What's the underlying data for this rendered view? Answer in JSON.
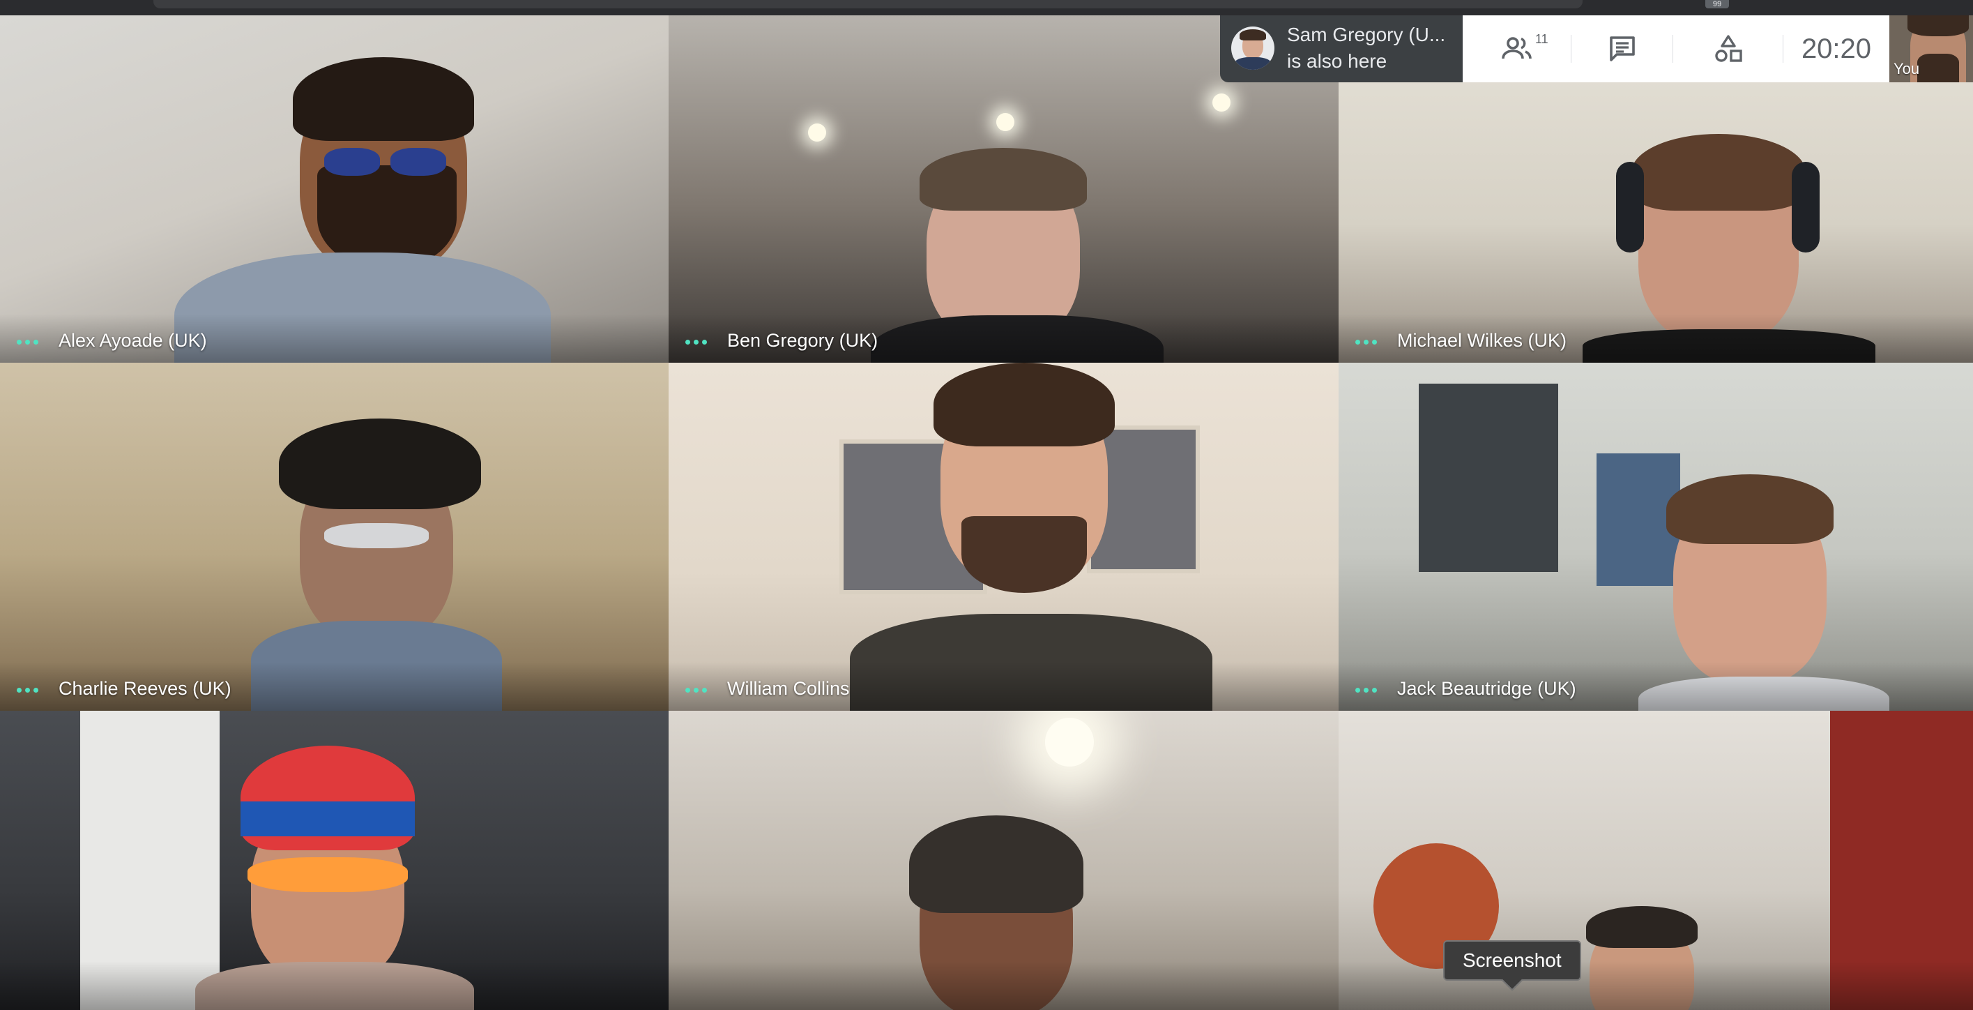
{
  "top_bar": {
    "notification_badge": "99"
  },
  "notification": {
    "name": "Sam Gregory (U...",
    "message": "is also here"
  },
  "controls": {
    "people_count": "11",
    "people_icon": "people-icon",
    "chat_icon": "chat-icon",
    "activities_icon": "activities-icon",
    "clock": "20:20"
  },
  "self_view": {
    "label": "You"
  },
  "participants": [
    {
      "name": "Alex Ayoade (UK)"
    },
    {
      "name": "Ben Gregory (UK)"
    },
    {
      "name": "Michael Wilkes (UK)"
    },
    {
      "name": "Charlie Reeves (UK)"
    },
    {
      "name": "William Collins"
    },
    {
      "name": "Jack Beautridge (UK)"
    },
    {
      "name": ""
    },
    {
      "name": ""
    },
    {
      "name": ""
    }
  ],
  "tooltip": {
    "label": "Screenshot"
  },
  "colors": {
    "speaking_dots": "#50e3c2",
    "control_bar_bg": "#ffffff",
    "notification_bg": "#3c4043"
  }
}
